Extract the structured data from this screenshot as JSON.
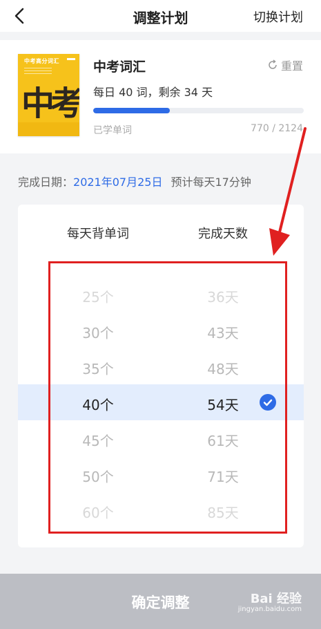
{
  "header": {
    "title": "调整计划",
    "switch_label": "切换计划"
  },
  "book": {
    "cover_title": "中考高分词汇",
    "cover_big_text": "中考",
    "name": "中考词汇",
    "reset_label": "重置",
    "plan_text": "每日 40 词，剩余 34 天",
    "progress_fraction": 0.363,
    "learned_label": "已学单词",
    "count_text": "770 / 2124"
  },
  "finish": {
    "label": "完成日期：",
    "date": "2021年07月25日",
    "estimate": "预计每天17分钟"
  },
  "picker": {
    "col_words": "每天背单词",
    "col_days": "完成天数",
    "rows": [
      {
        "words": "25个",
        "days": "36天"
      },
      {
        "words": "30个",
        "days": "43天"
      },
      {
        "words": "35个",
        "days": "48天"
      },
      {
        "words": "40个",
        "days": "54天"
      },
      {
        "words": "45个",
        "days": "61天"
      },
      {
        "words": "50个",
        "days": "71天"
      },
      {
        "words": "60个",
        "days": "85天"
      }
    ],
    "selected_index": 3
  },
  "footer": {
    "confirm_label": "确定调整",
    "watermark": "Bai 经验",
    "watermark_sub": "jingyan.baidu.com"
  },
  "colors": {
    "accent": "#2e6be6",
    "highlight": "#e02020",
    "selected_row": "#e3edfd"
  }
}
